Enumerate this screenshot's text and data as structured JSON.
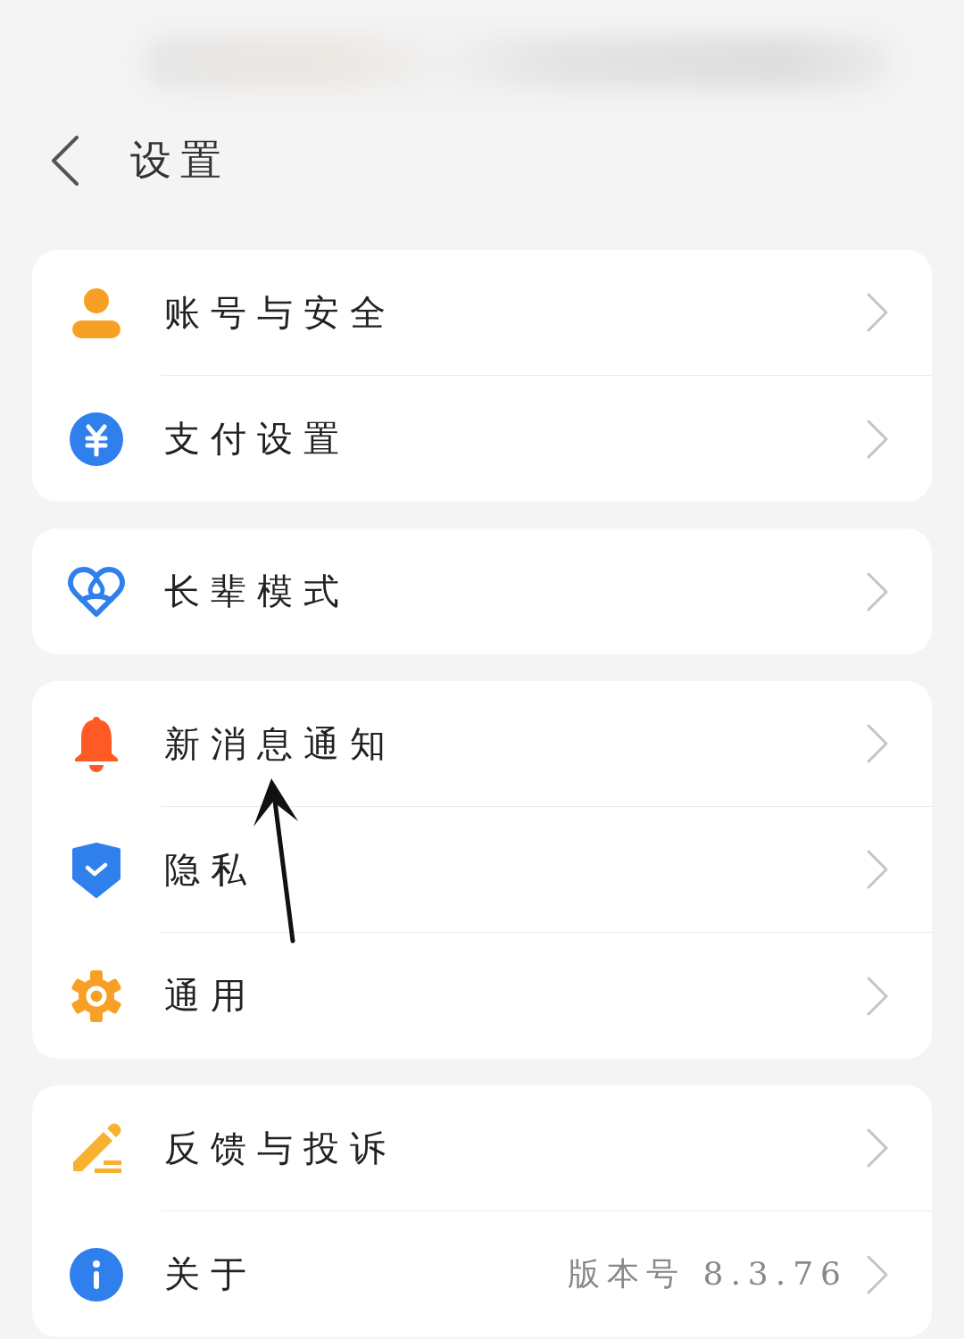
{
  "header": {
    "title": "设置"
  },
  "groups": [
    {
      "items": [
        {
          "label": "账号与安全"
        },
        {
          "label": "支付设置"
        }
      ]
    },
    {
      "items": [
        {
          "label": "长辈模式"
        }
      ]
    },
    {
      "items": [
        {
          "label": "新消息通知"
        },
        {
          "label": "隐私"
        },
        {
          "label": "通用"
        }
      ]
    },
    {
      "items": [
        {
          "label": "反馈与投诉"
        },
        {
          "label": "关于",
          "value": "版本号 8.3.76"
        }
      ]
    }
  ]
}
